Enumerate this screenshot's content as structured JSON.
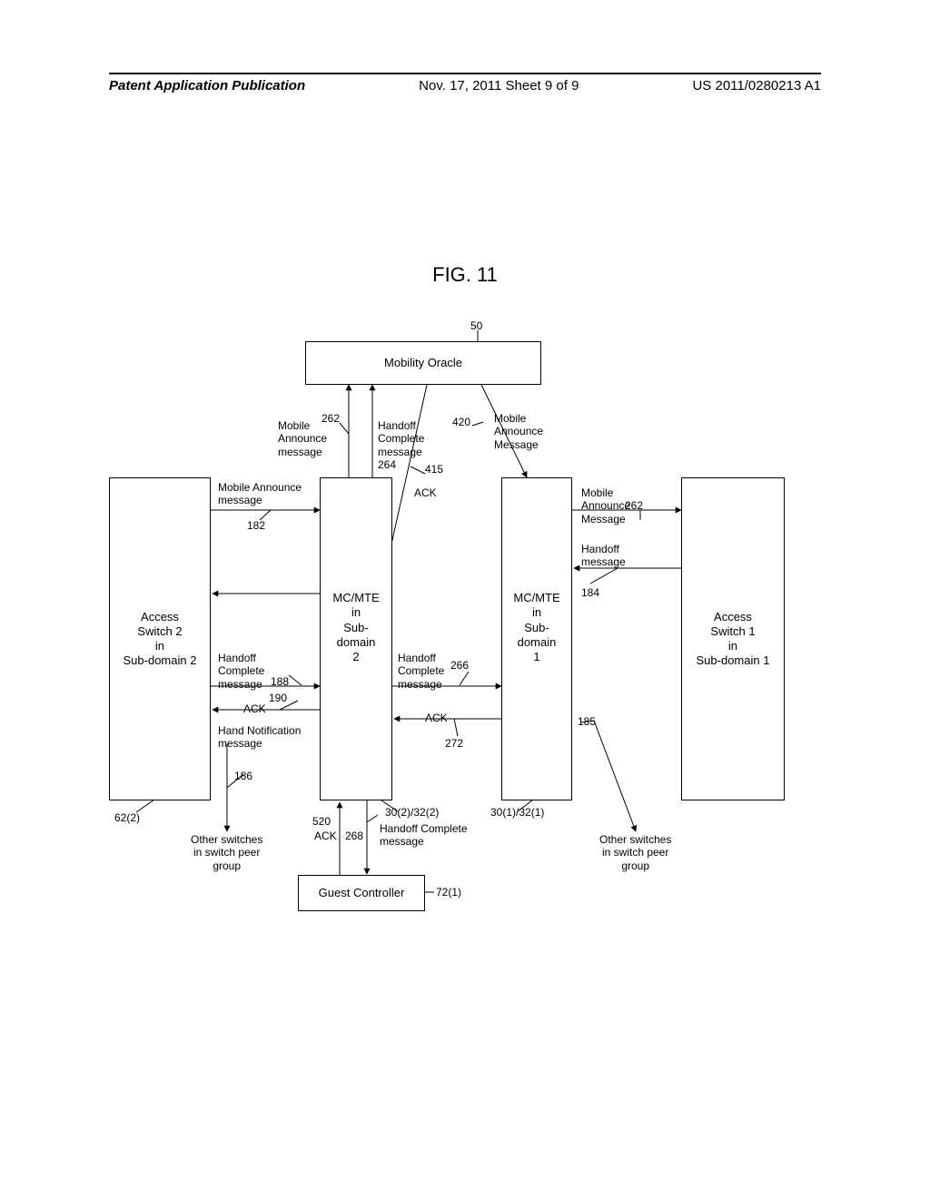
{
  "header": {
    "left": "Patent Application Publication",
    "center": "Nov. 17, 2011  Sheet 9 of 9",
    "right": "US 2011/0280213 A1"
  },
  "figure_title": "FIG. 11",
  "boxes": {
    "mobility_oracle": "Mobility Oracle",
    "access_switch_2": "Access\nSwitch 2\nin\nSub-domain 2",
    "mcmte_2": "MC/MTE\nin\nSub-domain\n2",
    "mcmte_1": "MC/MTE\nin\nSub-domain\n1",
    "access_switch_1": "Access\nSwitch 1\nin\nSub-domain 1",
    "guest_controller": "Guest Controller"
  },
  "labels": {
    "ref_50": "50",
    "mobile_announce_262_left": "Mobile\nAnnounce\nmessage",
    "ref_262_left": "262",
    "handoff_complete_264": "Handoff\nComplete\nmessage\n264",
    "ref_420": "420",
    "mobile_announce_right": "Mobile\nAnnounce\nMessage",
    "mobile_announce_182": "Mobile Announce\nmessage",
    "ref_182": "182",
    "ref_415": "415",
    "ack_415": "ACK",
    "mobile_announce_262_right": "Mobile\nAnnounce\nMessage",
    "ref_262_right": "262",
    "handoff_message_184": "Handoff\nmessage",
    "ref_184": "184",
    "handoff_complete_188": "Handoff\nComplete\nmessage",
    "ref_188": "188",
    "ack_190": "ACK",
    "ref_190": "190",
    "handoff_complete_266": "Handoff\nComplete\nmessage",
    "ref_266": "266",
    "ack_272_text": "ACK",
    "ref_272": "272",
    "hand_notification_186": "Hand Notification\nmessage",
    "ref_186": "186",
    "ref_185": "185",
    "ref_622": "62(2)",
    "other_switches_left": "Other switches\nin switch peer\ngroup",
    "ref_520": "520",
    "ack_520": "ACK",
    "ref_268": "268",
    "handoff_complete_268": "Handoff Complete\nmessage",
    "ref_302_322": "30(2)/32(2)",
    "ref_301_321": "30(1)/32(1)",
    "other_switches_right": "Other switches\nin switch peer\ngroup",
    "ref_721": "72(1)"
  }
}
